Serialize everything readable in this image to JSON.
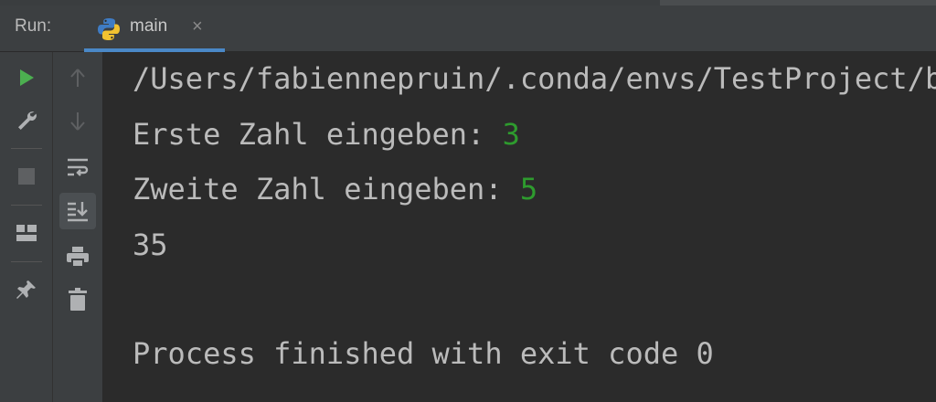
{
  "run_panel": {
    "label": "Run:",
    "tab": {
      "label": "main",
      "close_glyph": "×",
      "icon": "python-icon"
    }
  },
  "left_toolbar": {
    "buttons": [
      {
        "name": "run-button",
        "icon": "play-icon"
      },
      {
        "name": "settings-button",
        "icon": "wrench-icon"
      },
      {
        "name": "stop-button",
        "icon": "stop-icon"
      },
      {
        "name": "layout-button",
        "icon": "layout-icon"
      },
      {
        "name": "pin-button",
        "icon": "pin-icon"
      }
    ]
  },
  "inner_toolbar": {
    "buttons": [
      {
        "name": "scroll-up-button",
        "icon": "arrow-up-icon"
      },
      {
        "name": "scroll-down-button",
        "icon": "arrow-down-icon"
      },
      {
        "name": "soft-wrap-button",
        "icon": "soft-wrap-icon"
      },
      {
        "name": "scroll-to-end-button",
        "icon": "scroll-to-end-icon",
        "active": true
      },
      {
        "name": "print-button",
        "icon": "printer-icon"
      },
      {
        "name": "clear-button",
        "icon": "trash-icon"
      }
    ]
  },
  "console": {
    "lines": [
      {
        "text": "/Users/fabiennepruin/.conda/envs/TestProject/bin/python"
      },
      {
        "prompt": "Erste Zahl eingeben: ",
        "input": "3"
      },
      {
        "prompt": "Zweite Zahl eingeben: ",
        "input": "5"
      },
      {
        "text": "35"
      },
      {
        "text": ""
      },
      {
        "text": "Process finished with exit code 0"
      }
    ]
  },
  "colors": {
    "background": "#2b2b2b",
    "toolbar": "#3c3f41",
    "text": "#bbbbbb",
    "user_input": "#2e9b2e",
    "run_green": "#4caf50",
    "tab_accent": "#4a88c7"
  }
}
